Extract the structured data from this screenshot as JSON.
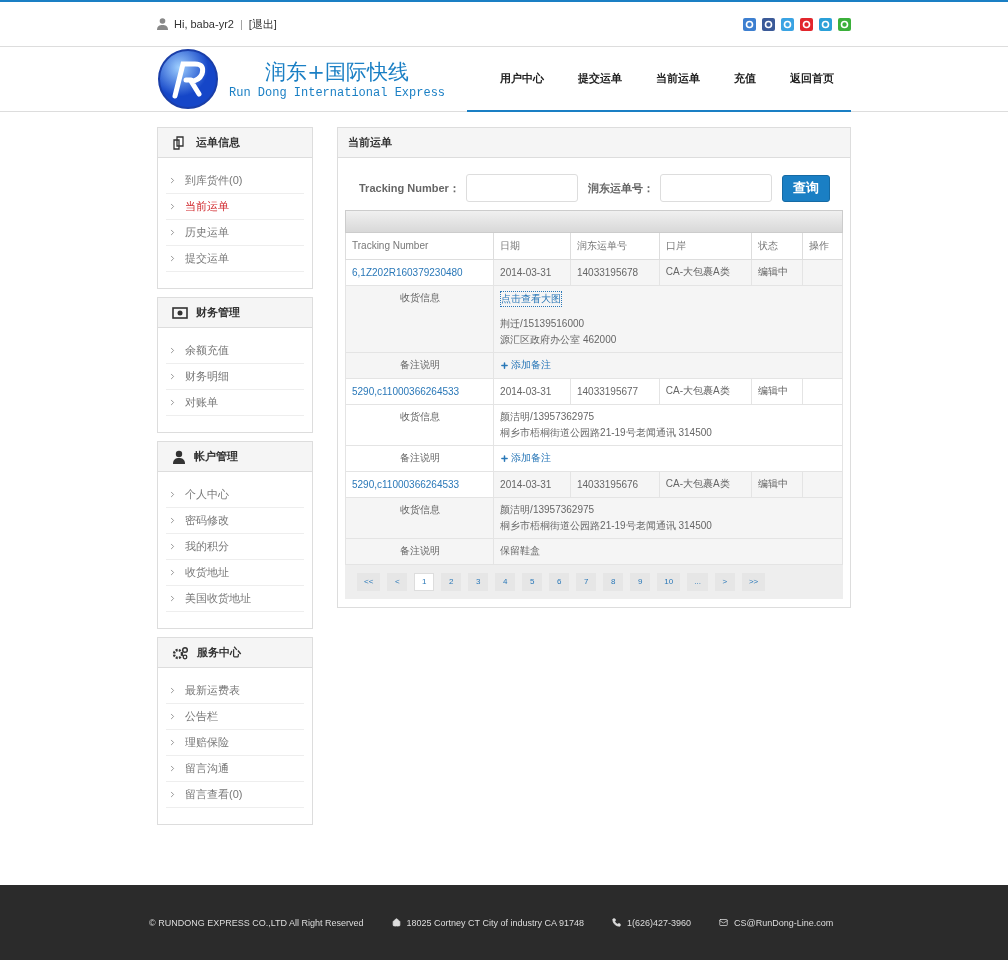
{
  "top_bar": {
    "greeting": "Hi, baba-yr2",
    "separator": "|",
    "logout": "[退出]"
  },
  "logo": {
    "title": "润东+国际快线",
    "subtitle": "Run Dong International Express"
  },
  "nav": [
    {
      "label": "用户中心"
    },
    {
      "label": "提交运单"
    },
    {
      "label": "当前运单"
    },
    {
      "label": "充值"
    },
    {
      "label": "返回首页"
    }
  ],
  "sidebar": [
    {
      "kind": "waybill",
      "title": "运单信息",
      "items": [
        {
          "label": "到库货件(0)",
          "selected": false
        },
        {
          "label": "当前运单",
          "selected": true
        },
        {
          "label": "历史运单",
          "selected": false
        },
        {
          "label": "提交运单",
          "selected": false
        }
      ]
    },
    {
      "kind": "money",
      "title": "财务管理",
      "items": [
        {
          "label": "余额充值",
          "selected": false
        },
        {
          "label": "财务明细",
          "selected": false
        },
        {
          "label": "对账单",
          "selected": false
        }
      ]
    },
    {
      "kind": "user",
      "title": "帐户管理",
      "items": [
        {
          "label": "个人中心",
          "selected": false
        },
        {
          "label": "密码修改",
          "selected": false
        },
        {
          "label": "我的积分",
          "selected": false
        },
        {
          "label": "收货地址",
          "selected": false
        },
        {
          "label": "美国收货地址",
          "selected": false
        }
      ]
    },
    {
      "kind": "gears",
      "title": "服务中心",
      "items": [
        {
          "label": "最新运费表",
          "selected": false
        },
        {
          "label": "公告栏",
          "selected": false
        },
        {
          "label": "理赔保险",
          "selected": false
        },
        {
          "label": "留言沟通",
          "selected": false
        },
        {
          "label": "留言查看(0)",
          "selected": false
        }
      ]
    }
  ],
  "panel": {
    "title": "当前运单",
    "search": {
      "fields": [
        {
          "label": "Tracking Number："
        },
        {
          "label": "润东运单号："
        }
      ],
      "button": "查询"
    },
    "table": {
      "columns": [
        "Tracking Number",
        "日期",
        "润东运单号",
        "口岸",
        "状态",
        "操作"
      ],
      "orders": [
        {
          "tracking": "6,1Z202R160379230480",
          "date": "2014-03-31",
          "number": "14033195678",
          "port": "CA-大包裹A类",
          "status": "编辑中",
          "info_label": "收货信息",
          "info_link": "点击查看大图",
          "info_lines": [
            "荆迁/15139516000",
            "源汇区政府办公室 462000"
          ],
          "note_label": "备注说明",
          "note": {
            "kind": "add",
            "text": "添加备注"
          }
        },
        {
          "tracking": "5290,c11000366264533",
          "date": "2014-03-31",
          "number": "14033195677",
          "port": "CA-大包裹A类",
          "status": "编辑中",
          "info_label": "收货信息",
          "info_lines": [
            "颜洁明/13957362975",
            "桐乡市梧桐街道公园路21-19号老闻通讯 314500"
          ],
          "note_label": "备注说明",
          "note": {
            "kind": "add",
            "text": "添加备注"
          }
        },
        {
          "tracking": "5290,c11000366264533",
          "date": "2014-03-31",
          "number": "14033195676",
          "port": "CA-大包裹A类",
          "status": "编辑中",
          "info_label": "收货信息",
          "info_lines": [
            "颜洁明/13957362975",
            "桐乡市梧桐街道公园路21-19号老闻通讯 314500"
          ],
          "note_label": "备注说明",
          "note": {
            "kind": "text",
            "text": "保留鞋盒"
          }
        }
      ]
    },
    "pagination": [
      {
        "label": "<<",
        "selected": false
      },
      {
        "label": "<",
        "selected": false
      },
      {
        "label": "1",
        "selected": true
      },
      {
        "label": "2",
        "selected": false
      },
      {
        "label": "3",
        "selected": false
      },
      {
        "label": "4",
        "selected": false
      },
      {
        "label": "5",
        "selected": false
      },
      {
        "label": "6",
        "selected": false
      },
      {
        "label": "7",
        "selected": false
      },
      {
        "label": "8",
        "selected": false
      },
      {
        "label": "9",
        "selected": false
      },
      {
        "label": "10",
        "selected": false
      },
      {
        "label": "...",
        "selected": false
      },
      {
        "label": ">",
        "selected": false
      },
      {
        "label": ">>",
        "selected": false
      }
    ]
  },
  "footer": {
    "copyright": "© RUNDONG EXPRESS CO.,LTD All Right Reserved",
    "address": "18025 Cortney CT City of industry CA 91748",
    "phone": "1(626)427-3960",
    "email": "CS@RunDong-Line.com"
  }
}
